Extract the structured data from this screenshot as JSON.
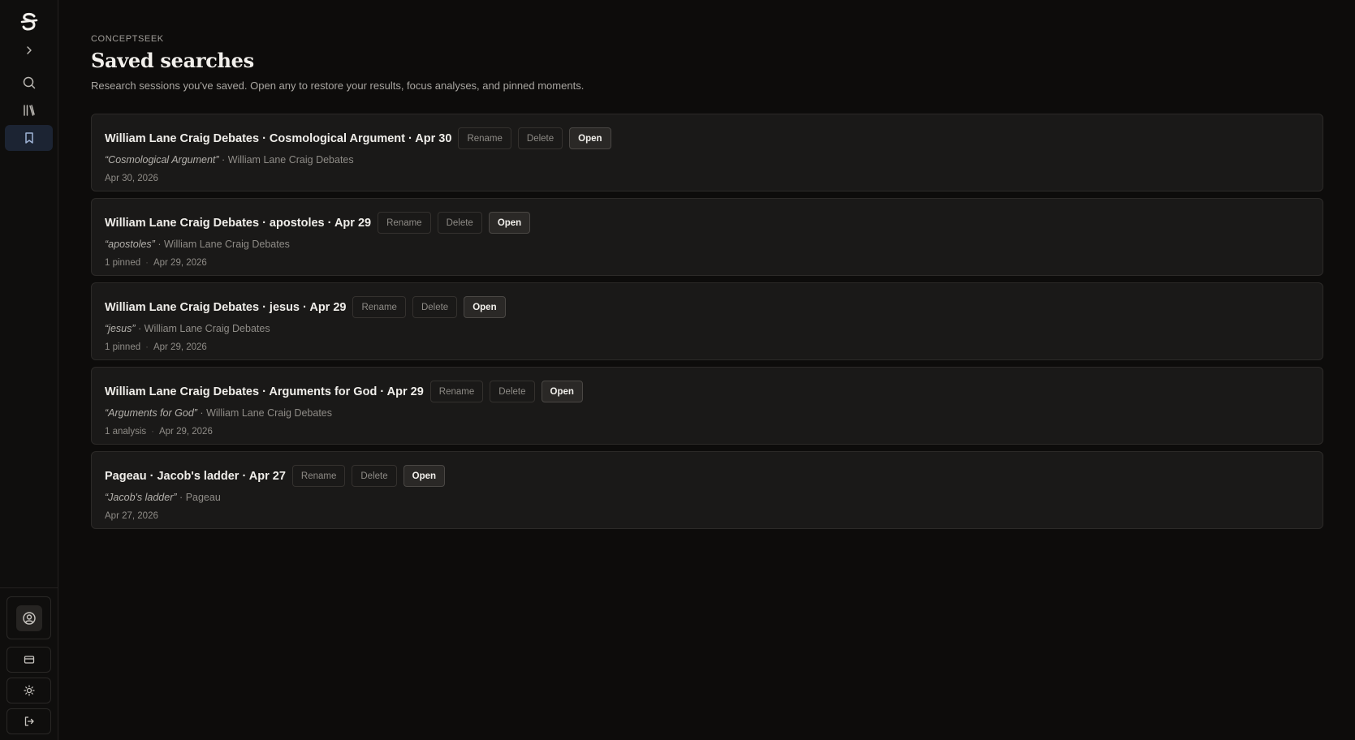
{
  "header": {
    "eyebrow": "CONCEPTSEEK",
    "title": "Saved searches",
    "subtitle": "Research sessions you've saved. Open any to restore your results, focus analyses, and pinned moments."
  },
  "buttons": {
    "rename": "Rename",
    "delete": "Delete",
    "open": "Open"
  },
  "separator": "·",
  "cards": [
    {
      "title": "William Lane Craig Debates · Cosmological Argument · Apr 30",
      "query": "“Cosmological Argument”",
      "source": "William Lane Craig Debates",
      "extra": "",
      "date": "Apr 30, 2026"
    },
    {
      "title": "William Lane Craig Debates · apostoles · Apr 29",
      "query": "“apostoles”",
      "source": "William Lane Craig Debates",
      "extra": "1 pinned",
      "date": "Apr 29, 2026"
    },
    {
      "title": "William Lane Craig Debates · jesus · Apr 29",
      "query": "“jesus”",
      "source": "William Lane Craig Debates",
      "extra": "1 pinned",
      "date": "Apr 29, 2026"
    },
    {
      "title": "William Lane Craig Debates · Arguments for God · Apr 29",
      "query": "“Arguments for God”",
      "source": "William Lane Craig Debates",
      "extra": "1 analysis",
      "date": "Apr 29, 2026"
    },
    {
      "title": "Pageau · Jacob's ladder · Apr 27",
      "query": "“Jacob's ladder”",
      "source": "Pageau",
      "extra": "",
      "date": "Apr 27, 2026"
    }
  ],
  "sidebar": {
    "icons": [
      "logo-icon",
      "expand-icon",
      "search-icon",
      "library-icon",
      "bookmark-icon",
      "user-icon",
      "billing-icon",
      "theme-icon",
      "logout-icon"
    ]
  }
}
